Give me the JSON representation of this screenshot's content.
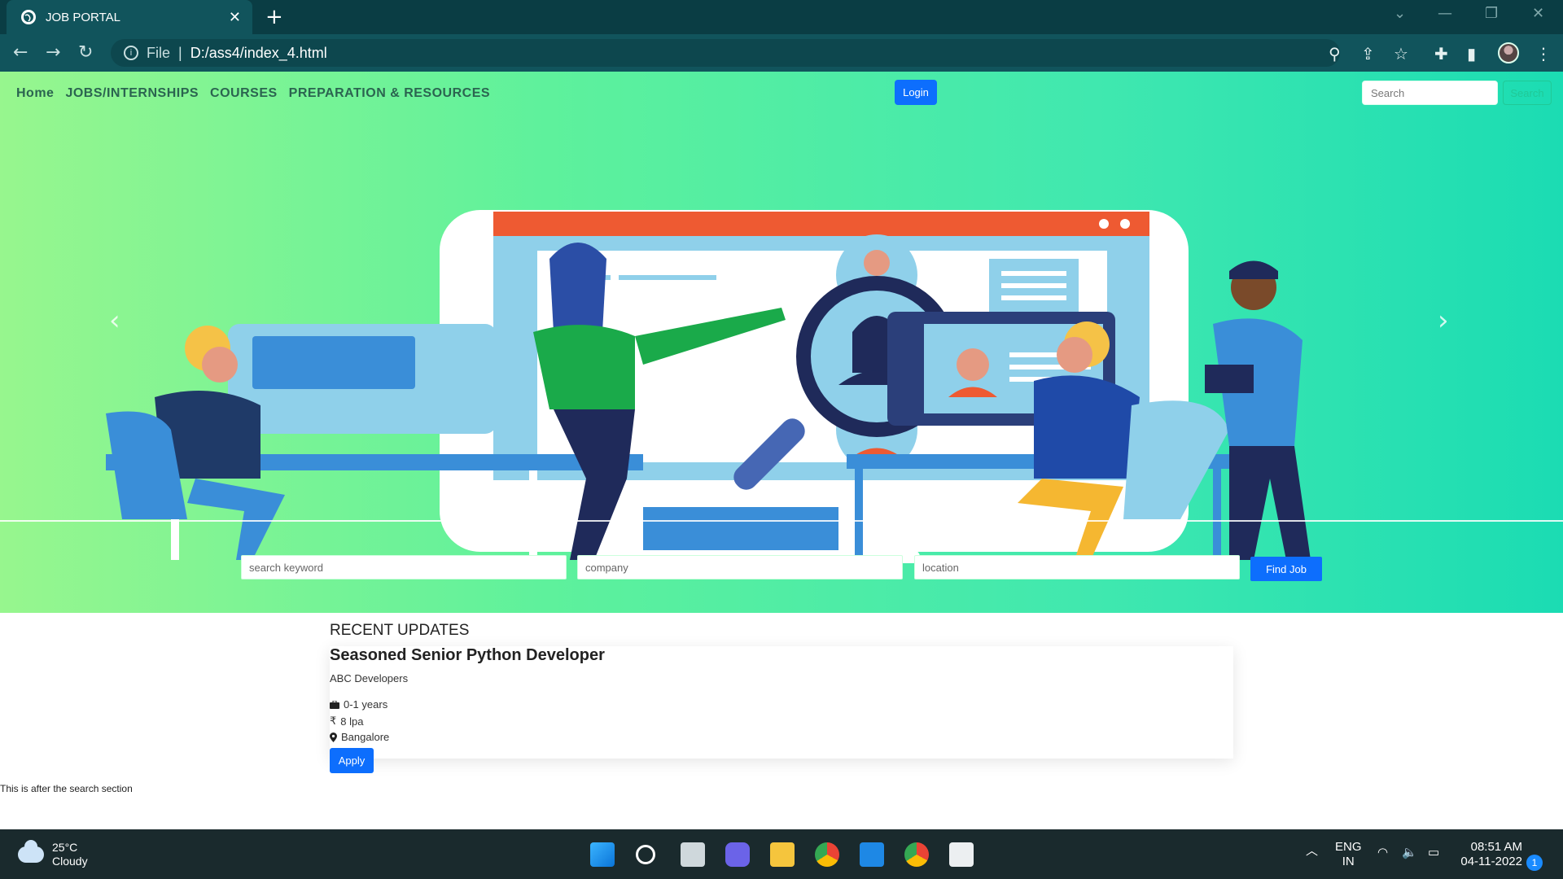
{
  "browser": {
    "tab_title": "JOB PORTAL",
    "tab_close": "✕",
    "new_tab": "+",
    "address_scheme": "File",
    "address_sep": "|",
    "address_url": "D:/ass4/index_4.html"
  },
  "nav": {
    "links": [
      "Home",
      "JOBS/INTERNSHIPS",
      "COURSES",
      "PREPARATION & RESOURCES"
    ],
    "login_label": "Login",
    "search_placeholder": "Search",
    "search_button": "Search"
  },
  "search": {
    "keyword_placeholder": "search keyword",
    "company_placeholder": "company",
    "location_placeholder": "location",
    "button": "Find Job"
  },
  "recent": {
    "heading": "RECENT UPDATES",
    "job": {
      "title": "Seasoned Senior Python Developer",
      "company": "ABC Developers",
      "experience": "0-1 years",
      "salary": "8 lpa",
      "location": "Bangalore",
      "apply_label": "Apply"
    }
  },
  "after_text": "This is after the search section",
  "taskbar": {
    "temperature": "25°C",
    "condition": "Cloudy",
    "lang_top": "ENG",
    "lang_bottom": "IN",
    "time": "08:51 AM",
    "date": "04-11-2022",
    "notifications": "1"
  },
  "colors": {
    "accent": "#0d6efd",
    "hero_start": "#97f68e",
    "hero_end": "#1bdcb3",
    "chrome": "#11545c"
  }
}
